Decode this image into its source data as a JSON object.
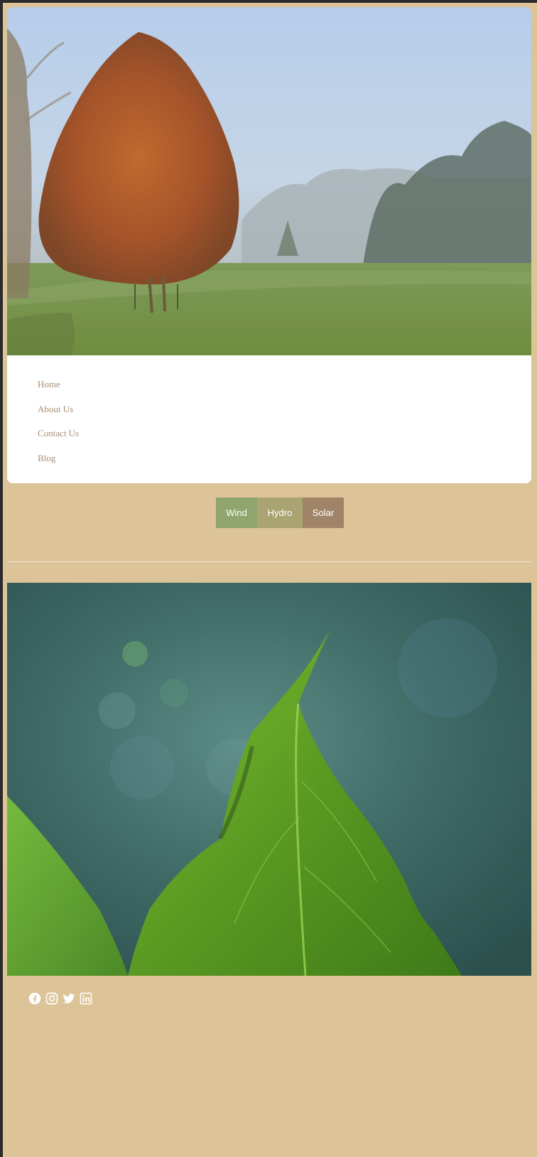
{
  "nav": {
    "items": [
      {
        "label": "Home"
      },
      {
        "label": "About Us"
      },
      {
        "label": "Contact Us"
      },
      {
        "label": "Blog"
      }
    ]
  },
  "tabs": [
    {
      "label": "Wind"
    },
    {
      "label": "Hydro"
    },
    {
      "label": "Solar"
    }
  ],
  "social": {
    "icons": [
      "facebook-icon",
      "instagram-icon",
      "twitter-icon",
      "linkedin-icon"
    ]
  },
  "colors": {
    "page_background": "#dcc398",
    "nav_text": "#a98d70",
    "tab_wind": "#8fa56d",
    "tab_hydro": "#a9a471",
    "tab_solar": "#a08467",
    "icon_color": "#ffffff"
  }
}
